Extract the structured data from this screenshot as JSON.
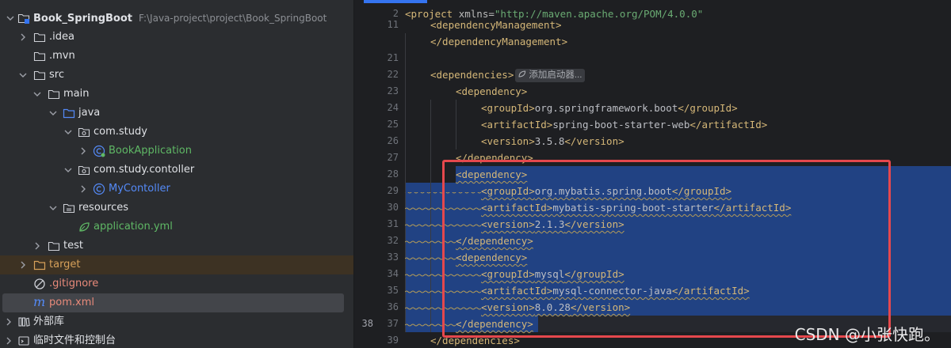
{
  "project": {
    "root_name": "Book_SpringBoot",
    "root_path": "F:\\Java-project\\project\\Book_SpringBoot",
    "items": [
      {
        "label": "Book_SpringBoot",
        "icon": "folder-module-icon"
      },
      {
        "label": ".idea",
        "icon": "folder-icon"
      },
      {
        "label": ".mvn",
        "icon": "folder-icon"
      },
      {
        "label": "src",
        "icon": "folder-icon"
      },
      {
        "label": "main",
        "icon": "folder-icon"
      },
      {
        "label": "java",
        "icon": "source-folder-icon"
      },
      {
        "label": "com.study",
        "icon": "package-icon"
      },
      {
        "label": "BookApplication",
        "icon": "spring-class-icon"
      },
      {
        "label": "com.study.contoller",
        "icon": "package-icon"
      },
      {
        "label": "MyContoller",
        "icon": "class-icon"
      },
      {
        "label": "resources",
        "icon": "resources-folder-icon"
      },
      {
        "label": "application.yml",
        "icon": "spring-config-icon"
      },
      {
        "label": "test",
        "icon": "folder-icon"
      },
      {
        "label": "target",
        "icon": "excluded-folder-icon"
      },
      {
        "label": ".gitignore",
        "icon": "ignore-icon"
      },
      {
        "label": "pom.xml",
        "icon": "maven-icon"
      },
      {
        "label": "外部库",
        "icon": "libraries-icon"
      },
      {
        "label": "临时文件和控制台",
        "icon": "scratches-icon"
      }
    ]
  },
  "editor": {
    "line_numbers": [
      "2",
      "11",
      "21",
      "22",
      "23",
      "24",
      "25",
      "26",
      "27",
      "28",
      "29",
      "30",
      "31",
      "32",
      "33",
      "34",
      "35",
      "36",
      "37",
      "38",
      "39"
    ],
    "current_line": "38",
    "hint_label": "添加启动器...",
    "lines": {
      "l2_open": "<project ",
      "l2_attr": "xmlns=",
      "l2_str": "\"http://maven.apache.org/POM/4.0.0\"",
      "l11": "<dependencyManagement>",
      "l21": "</dependencyManagement>",
      "l23": "<dependencies>",
      "l24": "<dependency>",
      "l25_open": "<groupId>",
      "l25_text": "org.springframework.boot",
      "l25_close": "</groupId>",
      "l26_open": "<artifactId>",
      "l26_text": "spring-boot-starter-web",
      "l26_close": "</artifactId>",
      "l27_open": "<version>",
      "l27_text": "3.5.8",
      "l27_close": "</version>",
      "l28": "</dependency>",
      "l29": "<dependency>",
      "l30_open": "<groupId>",
      "l30_text": "org.mybatis.spring.boot",
      "l30_close": "</groupId>",
      "l31_open": "<artifactId>",
      "l31_text": "mybatis-spring-boot-starter",
      "l31_close": "</artifactId>",
      "l32_open": "<version>",
      "l32_text": "2.1.3",
      "l32_close": "</version>",
      "l33": "</dependency>",
      "l34": "<dependency>",
      "l35_open": "<groupId>",
      "l35_text": "mysql",
      "l35_close": "</groupId>",
      "l36_open": "<artifactId>",
      "l36_text": "mysql-connector-java",
      "l36_close": "</artifactId>",
      "l37_open": "<version>",
      "l37_text": "8.0.28",
      "l37_close": "</version>",
      "l38": "</dependency>",
      "l39": "</dependencies>"
    }
  },
  "watermark": "CSDN @小张快跑。",
  "colors": {
    "selection": "#214283",
    "highlight_box": "#e5484d",
    "tag": "#d5b778",
    "string": "#6aab73"
  }
}
